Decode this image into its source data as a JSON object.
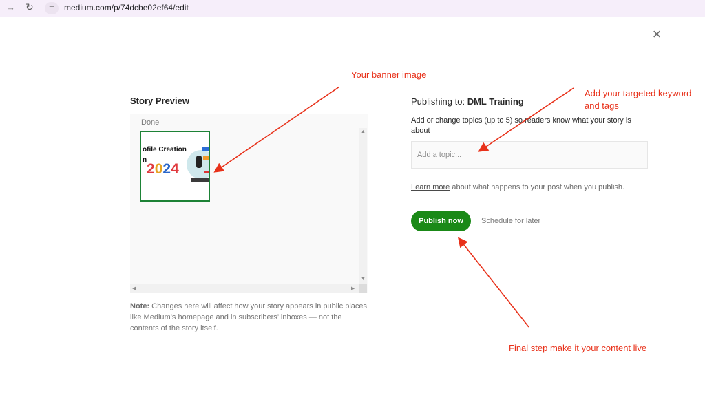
{
  "browser": {
    "url": "medium.com/p/74dcbe02ef64/edit",
    "forward_icon": "→",
    "reload_icon": "↻",
    "site_info_icon": "☰"
  },
  "dialog": {
    "close_icon": "×"
  },
  "preview": {
    "title": "Story Preview",
    "done_label": "Done",
    "thumbnail": {
      "line1": "ofile Creation",
      "line2": "n",
      "year": "2024",
      "year_colors": [
        "#e03a3e",
        "#e8a321",
        "#2a66c9",
        "#e03a3e"
      ]
    },
    "note_label": "Note:",
    "note_text": "Changes here will affect how your story appears in public places like Medium’s homepage and in subscribers’ inboxes — not the contents of the story itself."
  },
  "publish": {
    "publishing_to_label": "Publishing to:",
    "publication_name": "DML Training",
    "topics_description": "Add or change topics (up to 5) so readers know what your story is about",
    "topic_placeholder": "Add a topic...",
    "learn_more_link": "Learn more",
    "learn_more_text": "about what happens to your post when you publish.",
    "publish_button": "Publish now",
    "schedule_link": "Schedule for later"
  },
  "annotations": {
    "banner": "Your banner image",
    "keyword": "Add your targeted keyword and tags",
    "final": "Final step make it your content live",
    "color": "#e8311a"
  },
  "colors": {
    "publish_green": "#1a8917",
    "thumb_border": "#1d8236",
    "address_bar": "#f6eefa"
  }
}
